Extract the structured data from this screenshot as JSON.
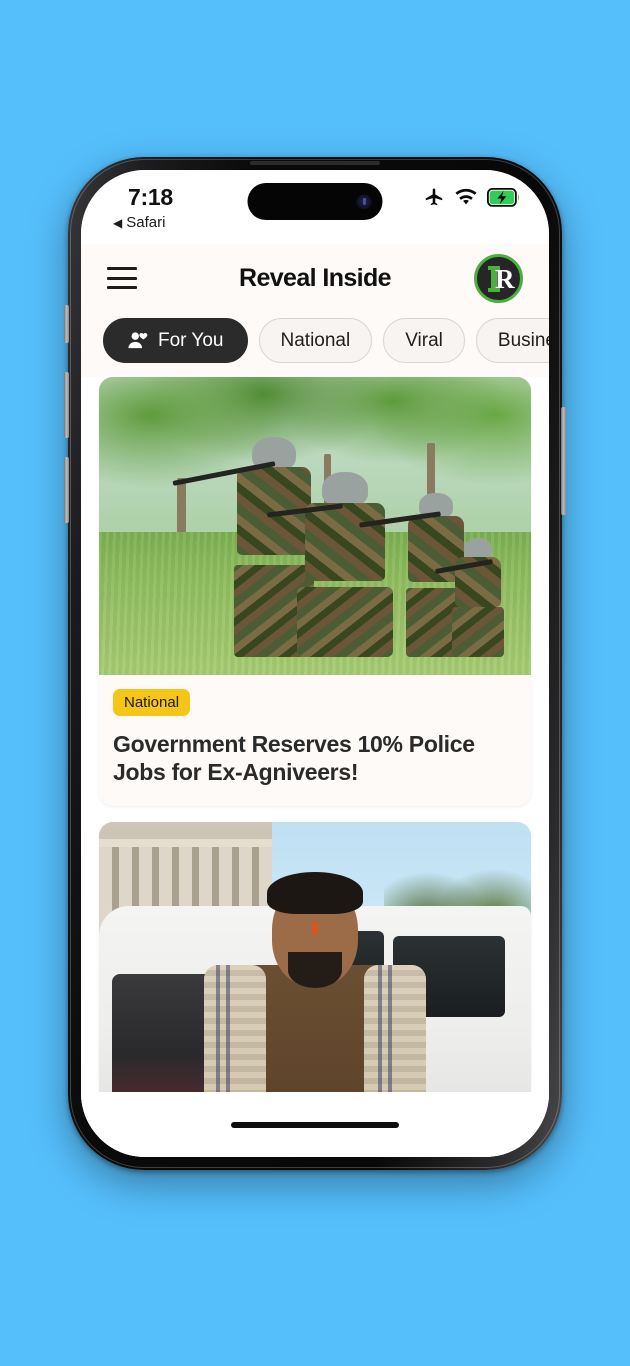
{
  "device": {
    "status_bar": {
      "time": "7:18",
      "back_label": "Safari",
      "back_arrow": "◀",
      "icons": [
        "airplane-mode-icon",
        "wifi-icon",
        "battery-charging-icon"
      ],
      "battery_state": "charging",
      "battery_color": "#33cc55"
    },
    "home_indicator": "home-indicator"
  },
  "header": {
    "menu_label": "menu",
    "title": "Reveal Inside",
    "logo_letter": "R",
    "logo_accent_color": "#4caf3f",
    "logo_bg_color": "#262626"
  },
  "chips": [
    {
      "label": "For You",
      "active": true,
      "icon": "person-heart-icon"
    },
    {
      "label": "National",
      "active": false,
      "icon": ""
    },
    {
      "label": "Viral",
      "active": false,
      "icon": ""
    },
    {
      "label": "Business",
      "active": false,
      "icon": ""
    },
    {
      "label": "",
      "active": false,
      "icon": ""
    }
  ],
  "feed": {
    "cards": [
      {
        "badge": "National",
        "badge_color": "#f5c518",
        "headline": "Government Reserves 10% Police Jobs for Ex-Agniveers!",
        "image_alt": "soldiers-training-photo"
      },
      {
        "badge": "",
        "headline": "",
        "image_alt": "politician-beside-white-suv-photo"
      }
    ]
  },
  "theme": {
    "page_background": "#55bffc",
    "app_background": "#ffffff",
    "card_background": "#fdfaf7",
    "accent_dark": "#2b2b2b"
  }
}
